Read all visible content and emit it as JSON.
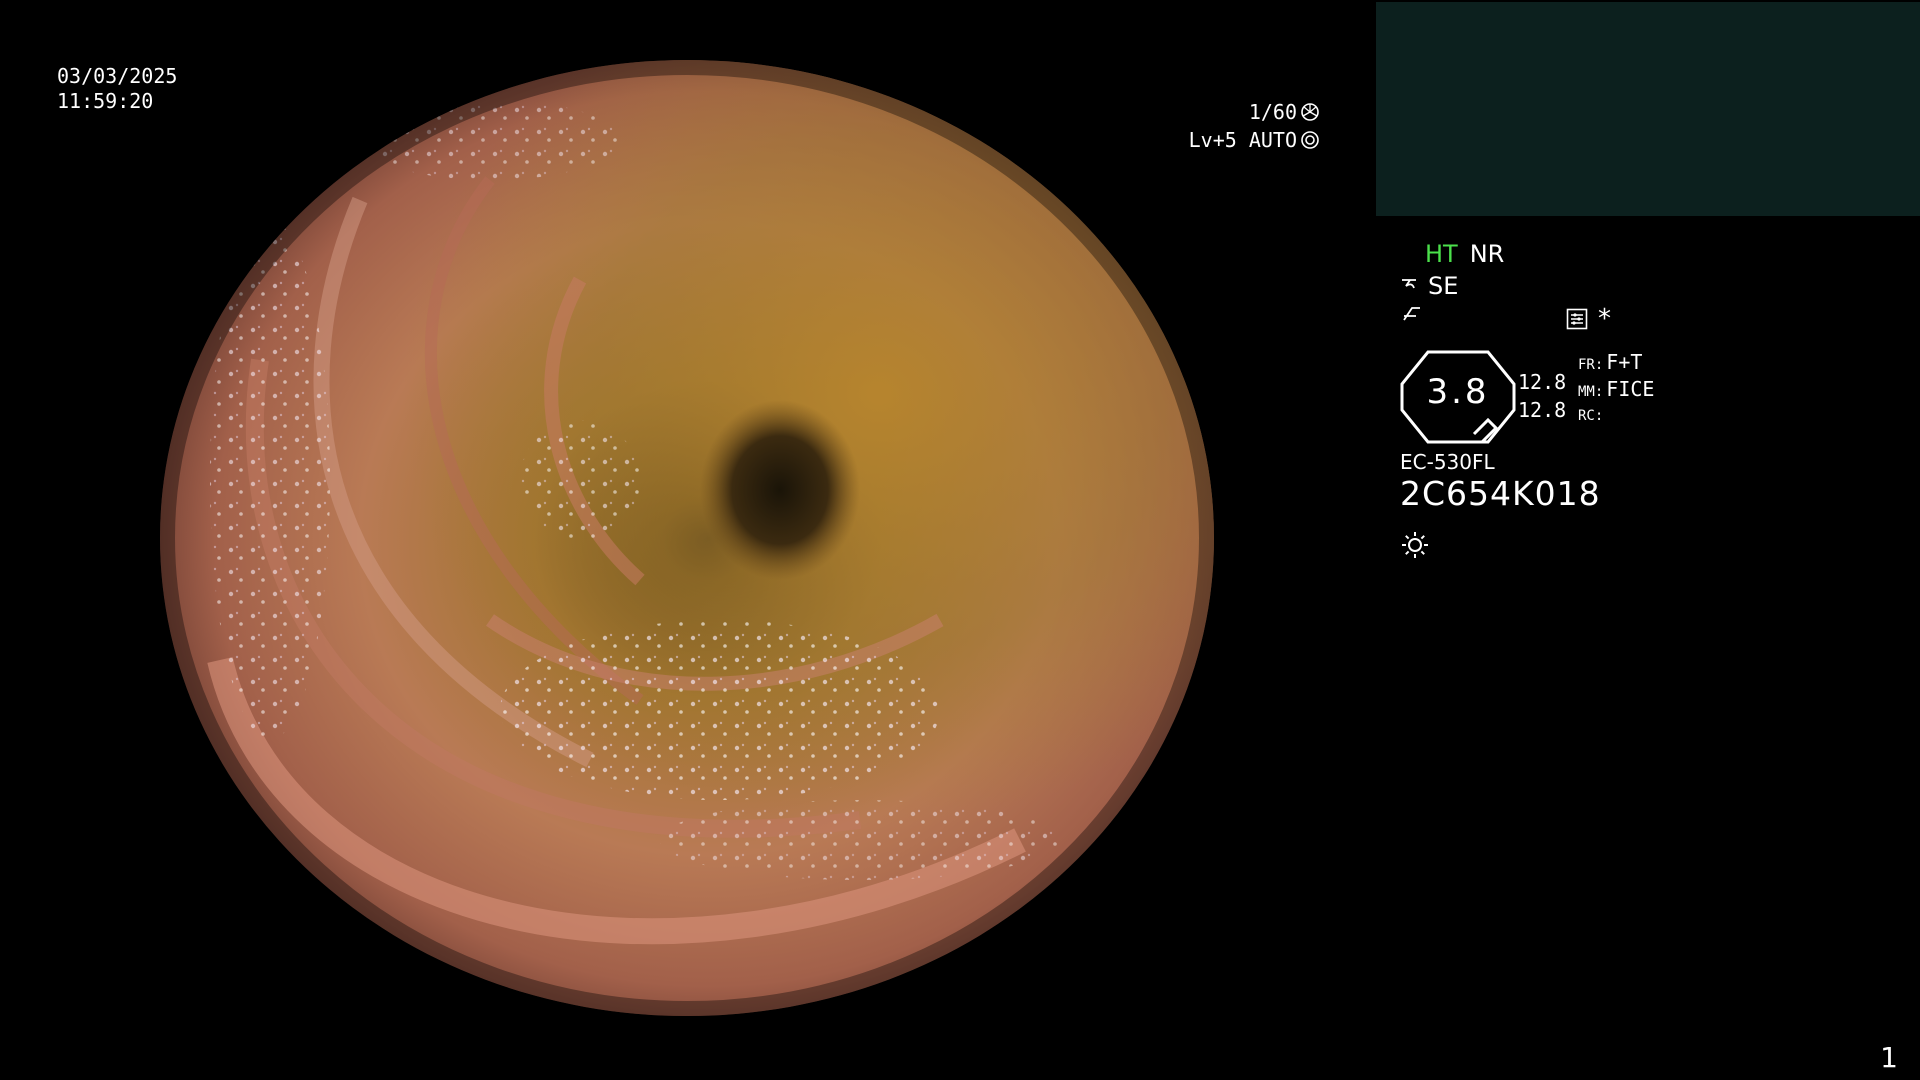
{
  "overlay": {
    "date": "03/03/2025",
    "time": "11:59:20",
    "shutter_speed": "1/60",
    "shutter_icon": "shutter-icon",
    "light_level": "Lv+5 AUTO",
    "light_icon": "light-mode-icon"
  },
  "side_panel": {
    "mode_ht": "HT",
    "mode_nr": "NR",
    "mode_ht_color": "#4be04b",
    "se_label": "SE",
    "se_icon": "structure-enhancement-icon",
    "iris_icon": "iris-icon",
    "settings_icon": "settings-icon",
    "star": "*",
    "zoom_value": "3.8",
    "enh_value_1": "12.8",
    "enh_value_2": "12.8",
    "fr_label": "FR:",
    "fr_value": "F+T",
    "mm_label": "MM:",
    "mm_value": "FICE",
    "rc_label": "RC:",
    "rc_value": "",
    "scope_model": "EC-530FL",
    "scope_serial": "2C654K018",
    "sun_icon": "sun-icon"
  },
  "thumbnail_panel": {
    "color": "#0c201e"
  },
  "frame_number": "1"
}
